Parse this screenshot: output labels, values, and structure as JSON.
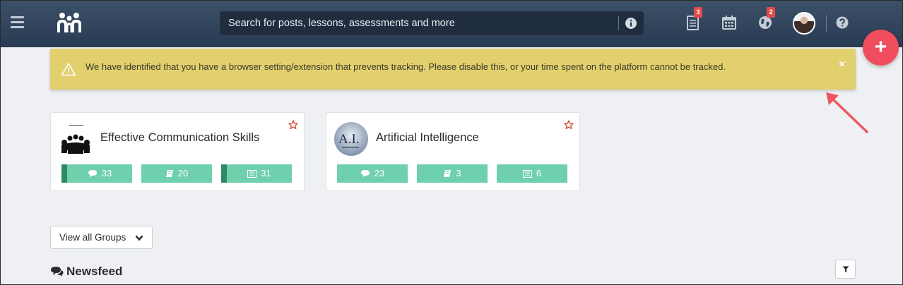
{
  "search": {
    "placeholder": "Search for posts, lessons, assessments and more"
  },
  "nav": {
    "notifications_badge": "3",
    "world_badge": "2"
  },
  "fab": {
    "label": "+"
  },
  "alert": {
    "message": "We have identified that you have a browser setting/extension that prevents tracking. Please disable this, or your time spent on the platform cannot be tracked.",
    "close": "×"
  },
  "groups": [
    {
      "title": "Effective Communication Skills",
      "comments": "33",
      "lessons": "20",
      "assessments": "31"
    },
    {
      "title": "Artificial Intelligence",
      "comments": "23",
      "lessons": "3",
      "assessments": "6",
      "thumb_text": "A.I."
    }
  ],
  "view_all": {
    "label": "View all Groups"
  },
  "newsfeed": {
    "title": "Newsfeed"
  },
  "colors": {
    "topbar": "#2f4259",
    "alert": "#e2cf6d",
    "stat": "#6fd0ae",
    "fab": "#f04e5e",
    "badge": "#e24b4b"
  }
}
